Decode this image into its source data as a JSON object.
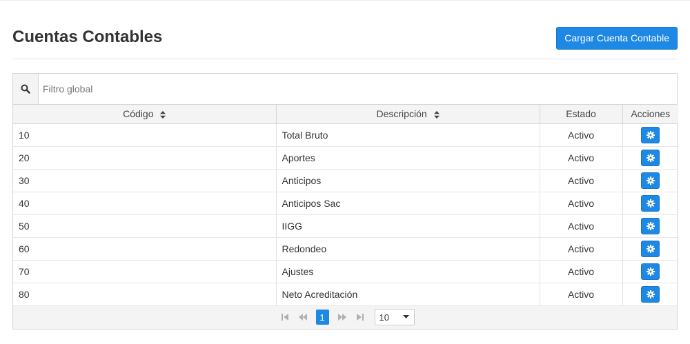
{
  "page": {
    "title": "Cuentas Contables",
    "add_button_label": "Cargar Cuenta Contable"
  },
  "filter": {
    "placeholder": "Filtro global",
    "value": "",
    "icon": "search-icon"
  },
  "table": {
    "columns": [
      {
        "label": "Código",
        "sortable": true
      },
      {
        "label": "Descripción",
        "sortable": true
      },
      {
        "label": "Estado",
        "sortable": false
      },
      {
        "label": "Acciones",
        "sortable": false
      }
    ],
    "rows": [
      {
        "codigo": "10",
        "descripcion": "Total Bruto",
        "estado": "Activo"
      },
      {
        "codigo": "20",
        "descripcion": "Aportes",
        "estado": "Activo"
      },
      {
        "codigo": "30",
        "descripcion": "Anticipos",
        "estado": "Activo"
      },
      {
        "codigo": "40",
        "descripcion": "Anticipos Sac",
        "estado": "Activo"
      },
      {
        "codigo": "50",
        "descripcion": "IIGG",
        "estado": "Activo"
      },
      {
        "codigo": "60",
        "descripcion": "Redondeo",
        "estado": "Activo"
      },
      {
        "codigo": "70",
        "descripcion": "Ajustes",
        "estado": "Activo"
      },
      {
        "codigo": "80",
        "descripcion": "Neto Acreditación",
        "estado": "Activo"
      }
    ],
    "action_icon": "gear-icon"
  },
  "paginator": {
    "current_page": "1",
    "rows_per_page": "10"
  },
  "colors": {
    "accent": "#1e88e5",
    "header_bg": "#f4f4f4"
  }
}
